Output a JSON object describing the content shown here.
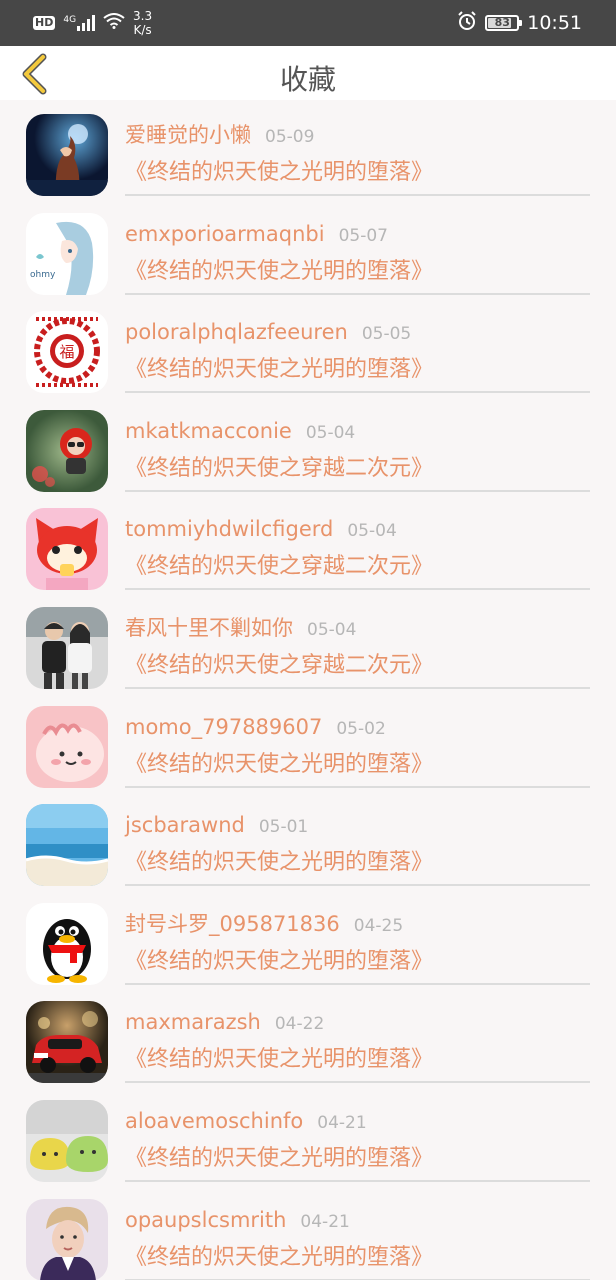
{
  "status_bar": {
    "hd": "HD",
    "signal": "4G",
    "speed_value": "3.3",
    "speed_unit": "K/s",
    "battery": "83",
    "battery_level": 0.83,
    "time": "10:51",
    "icons": [
      "signal-icon",
      "wifi-icon",
      "alarm-icon",
      "battery-icon"
    ]
  },
  "header": {
    "back_icon": "chevron-left-icon",
    "title": "收藏"
  },
  "colors": {
    "accent": "#e8936a",
    "back_arrow": "#f3c93c",
    "date": "#b6b6b6",
    "divider": "#dcdcdc"
  },
  "items": [
    {
      "name": "爱睡觉的小懒",
      "date": "05-09",
      "book": "《终结的炽天使之光明的堕落》",
      "avatar": "avatar-night-girl"
    },
    {
      "name": "emxporioarmaqnbi",
      "date": "05-07",
      "book": "《终结的炽天使之光明的堕落》",
      "avatar": "avatar-anime-girl"
    },
    {
      "name": "poloralphqlazfeeuren",
      "date": "05-05",
      "book": "《终结的炽天使之光明的堕落》",
      "avatar": "avatar-fu-papercut"
    },
    {
      "name": "mkatkmacconie",
      "date": "05-04",
      "book": "《终结的炽天使之穿越二次元》",
      "avatar": "avatar-apple-figure"
    },
    {
      "name": "tommiyhdwilcfigerd",
      "date": "05-04",
      "book": "《终结的炽天使之穿越二次元》",
      "avatar": "avatar-red-fox"
    },
    {
      "name": "春风十里不剿如你",
      "date": "05-04",
      "book": "《终结的炽天使之穿越二次元》",
      "avatar": "avatar-couple"
    },
    {
      "name": "momo_797889607",
      "date": "05-02",
      "book": "《终结的炽天使之光明的堕落》",
      "avatar": "avatar-pink-blob"
    },
    {
      "name": "jscbarawnd",
      "date": "05-01",
      "book": "《终结的炽天使之光明的堕落》",
      "avatar": "avatar-beach"
    },
    {
      "name": "封号斗罗_095871836",
      "date": "04-25",
      "book": "《终结的炽天使之光明的堕落》",
      "avatar": "avatar-qq-penguin"
    },
    {
      "name": "maxmarazsh",
      "date": "04-22",
      "book": "《终结的炽天使之光明的堕落》",
      "avatar": "avatar-red-car"
    },
    {
      "name": "aloavemoschinfo",
      "date": "04-21",
      "book": "《终结的炽天使之光明的堕落》",
      "avatar": "avatar-jelly"
    },
    {
      "name": "opaupslcsmrith",
      "date": "04-21",
      "book": "《终结的炽天使之光明的堕落》",
      "avatar": "avatar-young-man"
    }
  ]
}
